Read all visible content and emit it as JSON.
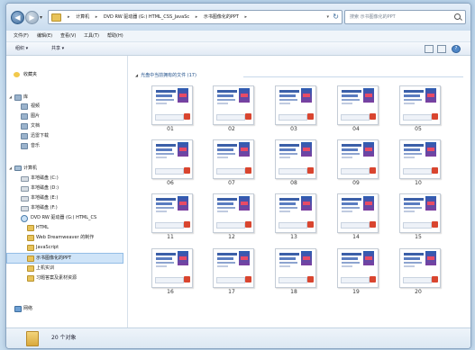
{
  "address": {
    "breadcrumbs": [
      "计算机",
      "DVD RW 驱动器 (G:) HTML_CSS_JavaSc",
      "示书图像化的PPT"
    ],
    "search_placeholder": "搜索 示书图像化的PPT"
  },
  "menu": {
    "items": [
      "文件(F)",
      "编辑(E)",
      "查看(V)",
      "工具(T)",
      "帮助(H)"
    ]
  },
  "toolbar": {
    "organize": "组织 ▾",
    "open": "共享 ▾"
  },
  "sidebar": {
    "favorites": "收藏夹",
    "libraries_header": "库",
    "libraries": [
      "视频",
      "图片",
      "文档",
      "迅雷下载",
      "音乐"
    ],
    "computer_header": "计算机",
    "drives": [
      "本地磁盘 (C:)",
      "本地磁盘 (D:)",
      "本地磁盘 (E:)",
      "本地磁盘 (F:)",
      "DVD RW 驱动器 (G:) HTML_CS"
    ],
    "subfolders": [
      "HTML",
      "Web Dreamweaver 的制作",
      "JavaScript",
      "示书图像化的PPT",
      "上机实训",
      "习题答案及素材资源"
    ],
    "network": "网络"
  },
  "content": {
    "group_header": "光盘中当前拥有的文件 (17)",
    "thumbs": [
      "01",
      "02",
      "03",
      "04",
      "05",
      "06",
      "07",
      "08",
      "09",
      "10",
      "11",
      "12",
      "13",
      "14",
      "15",
      "16",
      "17",
      "18",
      "19",
      "20"
    ]
  },
  "status": {
    "count_text": "20 个对象"
  },
  "colors": {
    "accent": "#1e4f8a",
    "folder": "#e8c35a",
    "window_bg": "#f4f8fc"
  }
}
